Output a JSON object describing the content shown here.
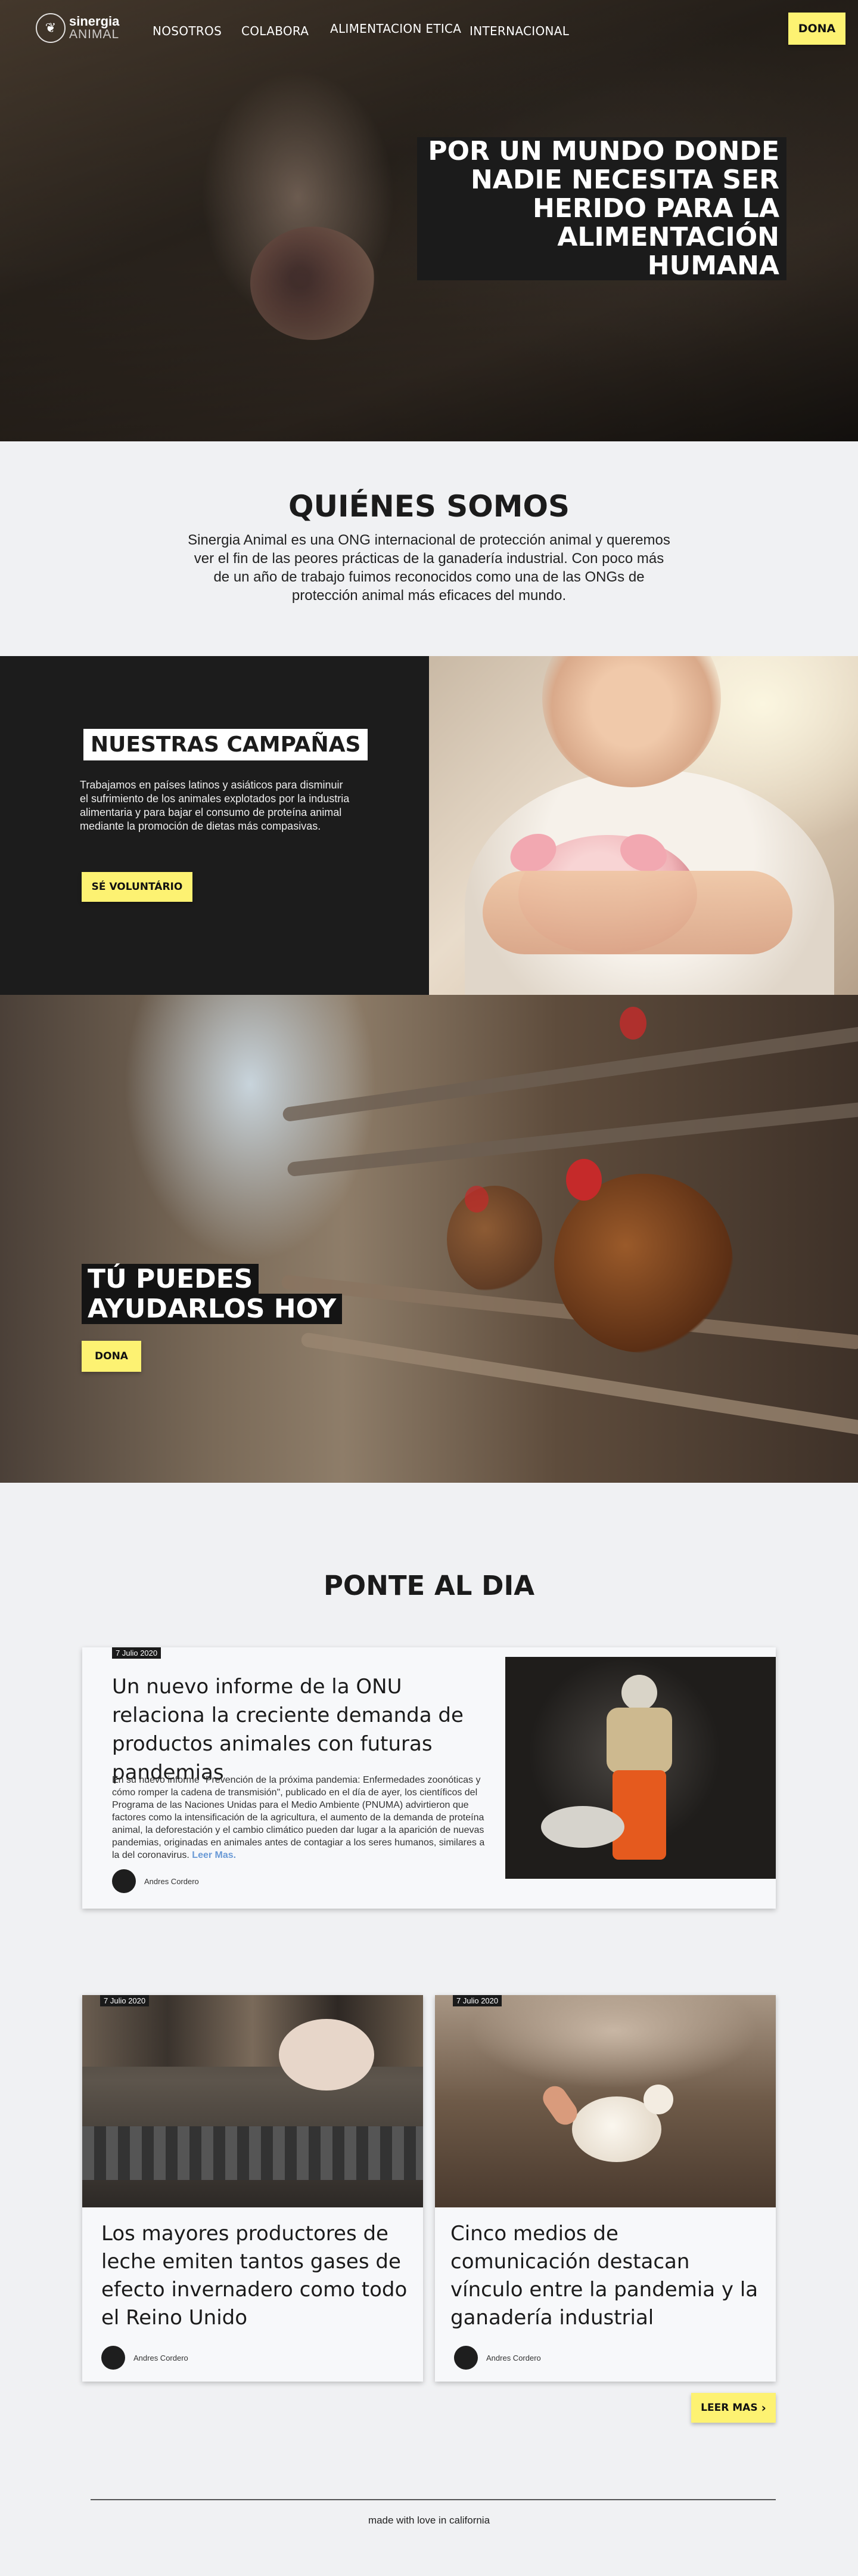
{
  "nav": {
    "logo_line1": "sinergia",
    "logo_line2": "ANIMAL",
    "links": [
      "NOSOTROS",
      "COLABORA",
      "ALIMENTACION ETICA",
      "INTERNACIONAL"
    ],
    "dona": "DONA"
  },
  "hero": {
    "title": "POR UN MUNDO DONDE NADIE NECESITA SER HERIDO PARA LA ALIMENTACIÓN HUMANA"
  },
  "quienes": {
    "title": "QUIÉNES SOMOS",
    "text": "Sinergia Animal es una ONG internacional de protección animal y queremos ver el fin de las peores prácticas de la ganadería industrial. Con poco más de un año de trabajo fuimos reconocidos como una de las ONGs de protección animal más eficaces del mundo."
  },
  "campanas": {
    "title": "NUESTRAS CAMPAÑAS",
    "text": "Trabajamos en países latinos y asiáticos para disminuir el sufrimiento de los animales explotados por la industria alimentaria y para bajar el consumo de proteína animal mediante la promoción de dietas más compasivas.",
    "button": "SÉ VOLUNTÁRIO"
  },
  "ayuda": {
    "title_line1": "TÚ PUEDES",
    "title_line2": "AYUDARLOS HOY",
    "button": "DONA"
  },
  "ponte": {
    "title": "PONTE AL DIA",
    "featured": {
      "date": "7 Julio 2020",
      "title": "Un nuevo informe de la ONU relaciona la creciente demanda de productos animales con futuras pandemias",
      "body": "En su nuevo informe \"Prevención de la próxima pandemia: Enfermedades zoonóticas y cómo romper la cadena de transmisión\", publicado en el día de ayer, los científicos del Programa de las Naciones Unidas para el Medio Ambiente (PNUMA) advirtieron que factores como la intensificación de la agricultura, el aumento de la demanda de proteína animal, la deforestación y el cambio climático pueden dar lugar a la aparición de nuevas pandemias, originadas en animales antes de contagiar a los seres humanos, similares a la del coronavirus.",
      "read_more": "Leer Mas.",
      "author": "Andres Cordero"
    },
    "cards": [
      {
        "date": "7 Julio 2020",
        "title": "Los mayores productores de leche emiten tantos gases de efecto invernadero como todo el Reino Unido",
        "author": "Andres Cordero"
      },
      {
        "date": "7 Julio 2020",
        "title": "Cinco medios de comunicación destacan vínculo entre la pandemia y la ganadería industrial",
        "author": "Andres Cordero"
      }
    ],
    "leer_mas": "LEER MAS"
  },
  "footer": {
    "text": "made with love in california"
  },
  "colors": {
    "accent_yellow": "#fdf272",
    "dark": "#1c1c1c",
    "page_bg": "#f0f1f3",
    "link_blue": "#6a9ad6"
  }
}
